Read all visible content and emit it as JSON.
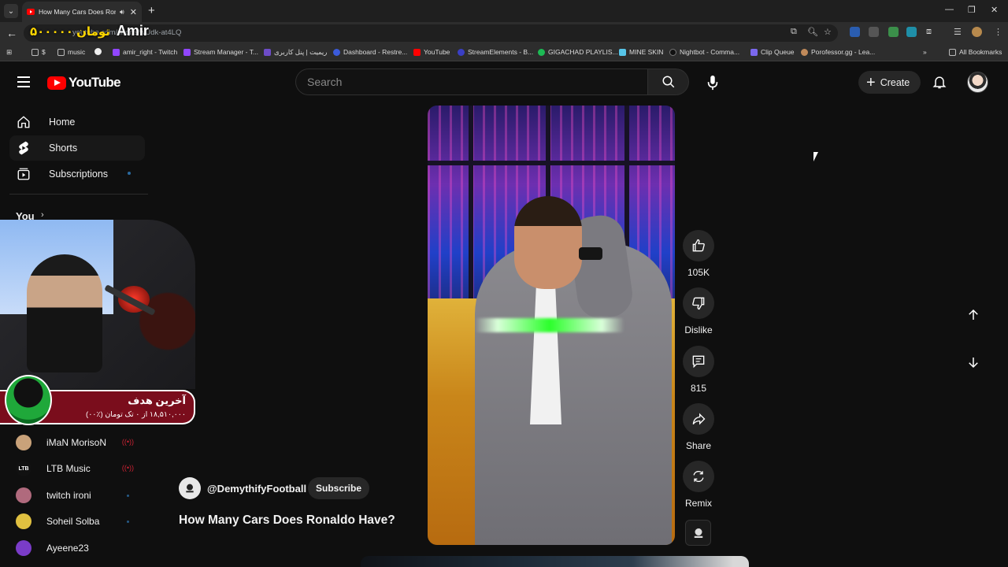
{
  "browser": {
    "tab_title": "How Many Cars Does Ronaldo",
    "url": "youtube.com/shorts/wUdk-at4LQ",
    "overlay_name": "Amir",
    "overlay_amount": "۵۰۰۰۰۰ تومان",
    "bookmarks": [
      "$",
      "music",
      "",
      "amir_right - Twitch",
      "Stream Manager - T...",
      "ریمیت | پنل کاربری",
      "Dashboard - Restre...",
      "YouTube",
      "StreamElements - B...",
      "GIGACHAD PLAYLIS...",
      "MINE SKIN",
      "Nightbot - Comma...",
      "Clip Queue",
      "Porofessor.gg - Lea..."
    ],
    "all_bookmarks": "All Bookmarks"
  },
  "masthead": {
    "logo_text": "YouTube",
    "search_placeholder": "Search",
    "create_label": "Create"
  },
  "sidebar": {
    "items": [
      {
        "label": "Home",
        "icon": "home-icon"
      },
      {
        "label": "Shorts",
        "icon": "shorts-icon"
      },
      {
        "label": "Subscriptions",
        "icon": "subscriptions-icon"
      }
    ],
    "you_label": "You",
    "subscriptions": [
      {
        "name": "iMaN MorisoN",
        "status": "live",
        "color": "#c9a27a"
      },
      {
        "name": "LTB Music",
        "status": "live",
        "color": "#111111",
        "abbr": "LTB"
      },
      {
        "name": "twitch ironi",
        "status": "new",
        "color": "#b06a7d"
      },
      {
        "name": "Soheil Solba",
        "status": "new",
        "color": "#e0c040"
      },
      {
        "name": "Ayeene23",
        "status": "",
        "color": "#7a3cc8"
      }
    ]
  },
  "stream_goal": {
    "title": "آخرین هدف",
    "progress_text": "۱۸,۵۱۰,۰۰۰ از ۰ تک تومان (٪۰۰)"
  },
  "short": {
    "likes": "105K",
    "dislike_label": "Dislike",
    "comments": "815",
    "share_label": "Share",
    "remix_label": "Remix",
    "channel_handle": "@DemythifyFootball",
    "subscribe_label": "Subscribe",
    "title": "How Many Cars Does Ronaldo Have?"
  },
  "colors": {
    "background": "#0f0f0f",
    "youtube_red": "#ff0000",
    "goal_banner": "#7a0d1c"
  }
}
